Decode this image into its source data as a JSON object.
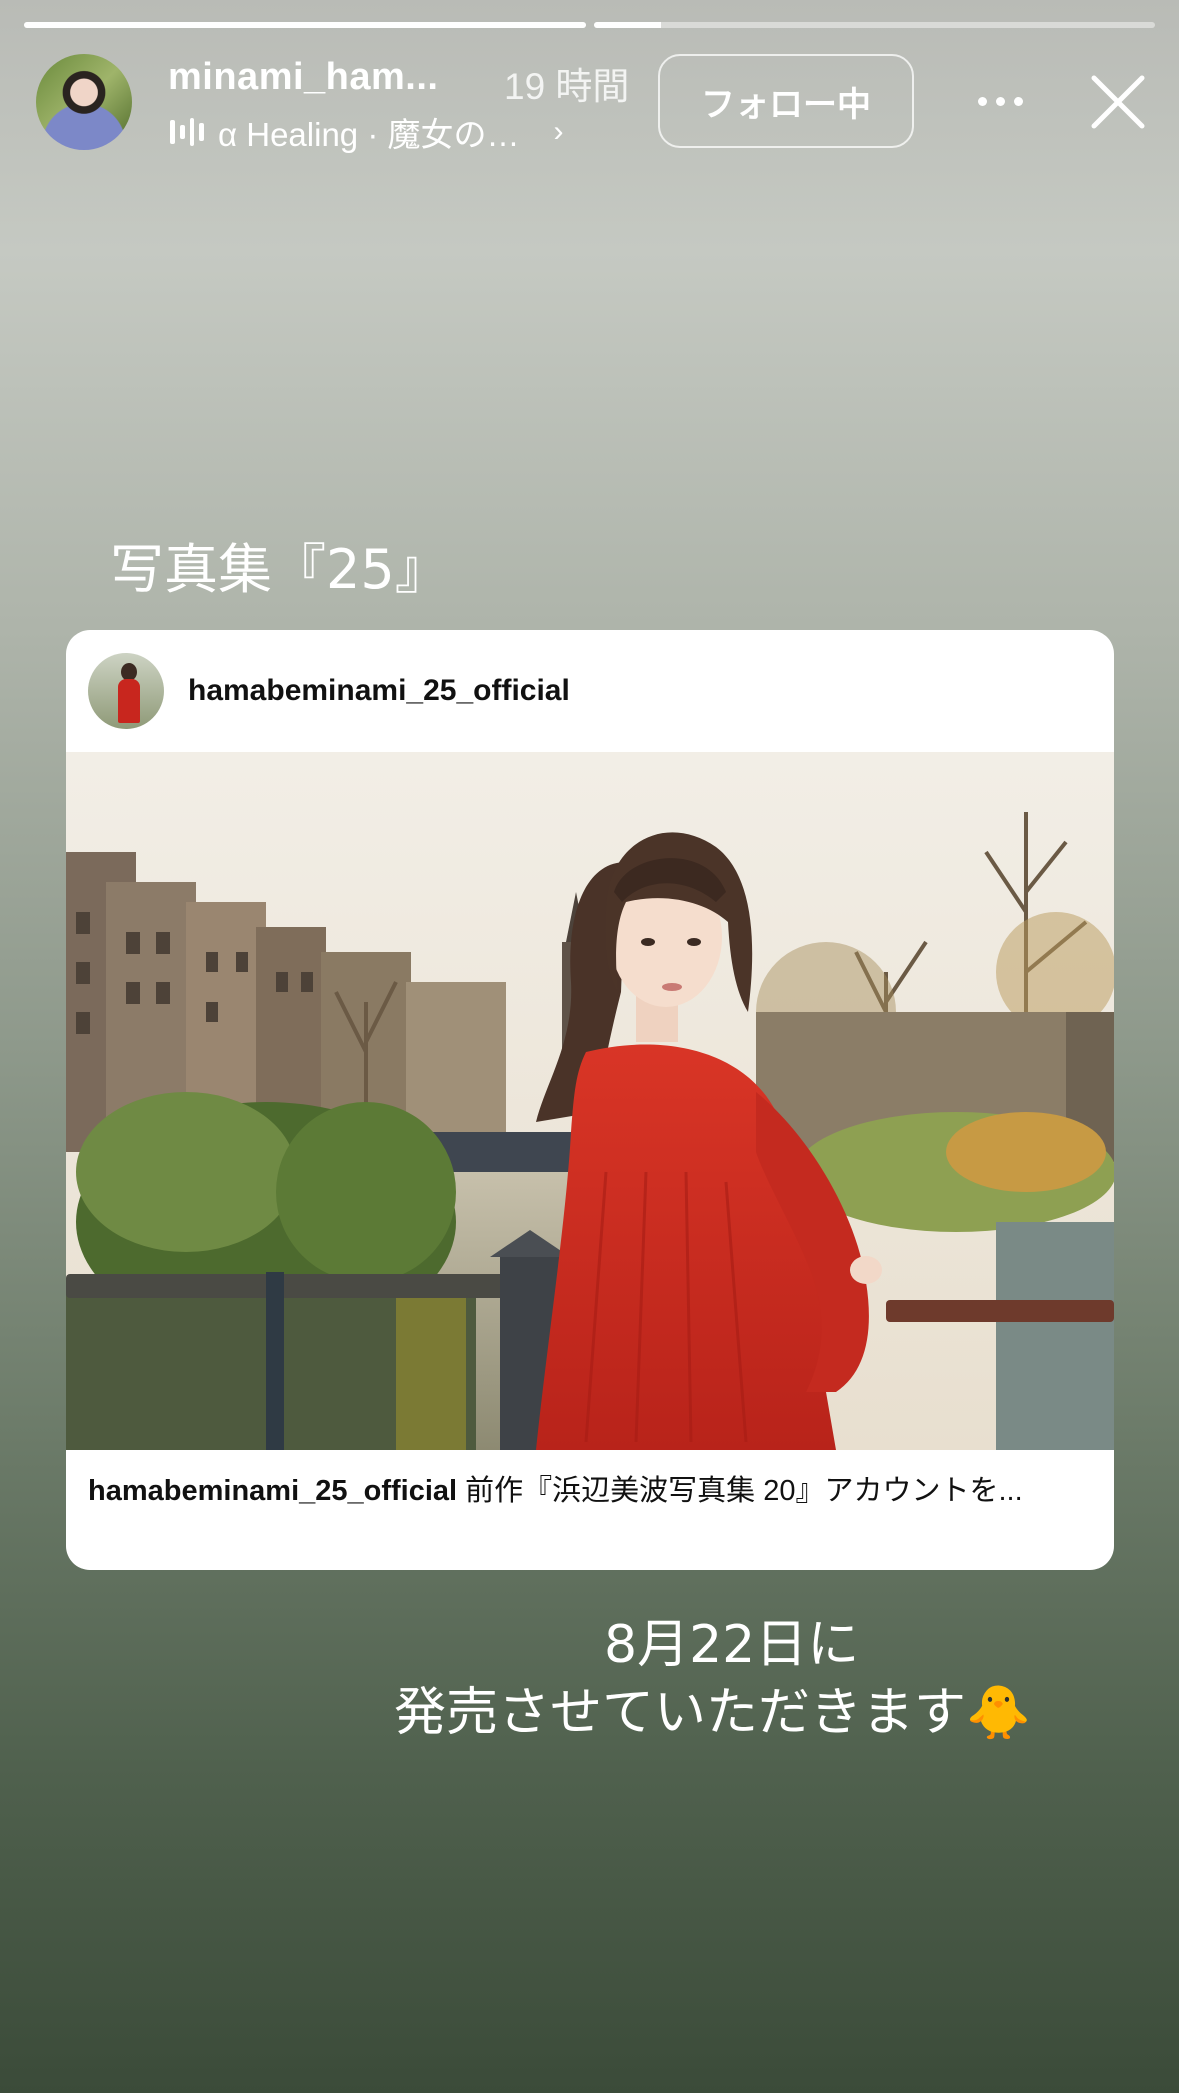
{
  "story": {
    "progress": [
      1.0,
      0.12
    ],
    "user": {
      "username": "minami_ham...",
      "time": "19 時間"
    },
    "music": {
      "label": "α Healing · 魔女の…"
    },
    "follow_label": "フォロー中",
    "icons": {
      "more": "more-horizontal-icon",
      "close": "close-icon",
      "music": "music-bars-icon",
      "chevron": "chevron-right-icon"
    }
  },
  "overlay": {
    "title": "写真集『25』",
    "release_line1": "8月22日に",
    "release_line2": "発売させていただきます🐥"
  },
  "post": {
    "username": "hamabeminami_25_official",
    "caption_user": "hamabeminami_25_official",
    "caption_text": " 前作『浜辺美波写真集 20』アカウントを..."
  },
  "colors": {
    "dress": "#c8261e",
    "background_top": "#c5c9c2",
    "background_bottom": "#3b4b39"
  }
}
